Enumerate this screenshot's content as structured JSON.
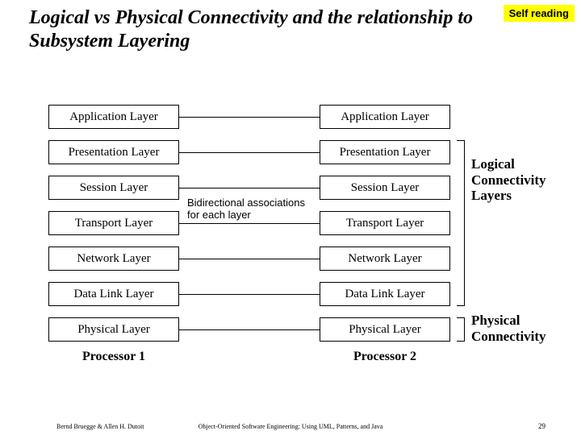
{
  "title": "Logical vs Physical Connectivity and the relationship to Subsystem Layering",
  "badge": "Self reading",
  "layers": [
    "Application Layer",
    "Presentation Layer",
    "Session Layer",
    "Transport Layer",
    "Network Layer",
    "Data Link Layer",
    "Physical Layer"
  ],
  "processors": {
    "p1": "Processor 1",
    "p2": "Processor 2"
  },
  "midnote": "Bidirectional associa­tions for each layer",
  "annotations": {
    "logical": "Logical Connectivity Layers",
    "physical": "Physical Connectivity"
  },
  "footer": {
    "left": "Bernd Bruegge & Allen H. Dutoit",
    "center": "Object-Oriented Software Engineering: Using UML, Patterns, and Java",
    "page": "29"
  }
}
